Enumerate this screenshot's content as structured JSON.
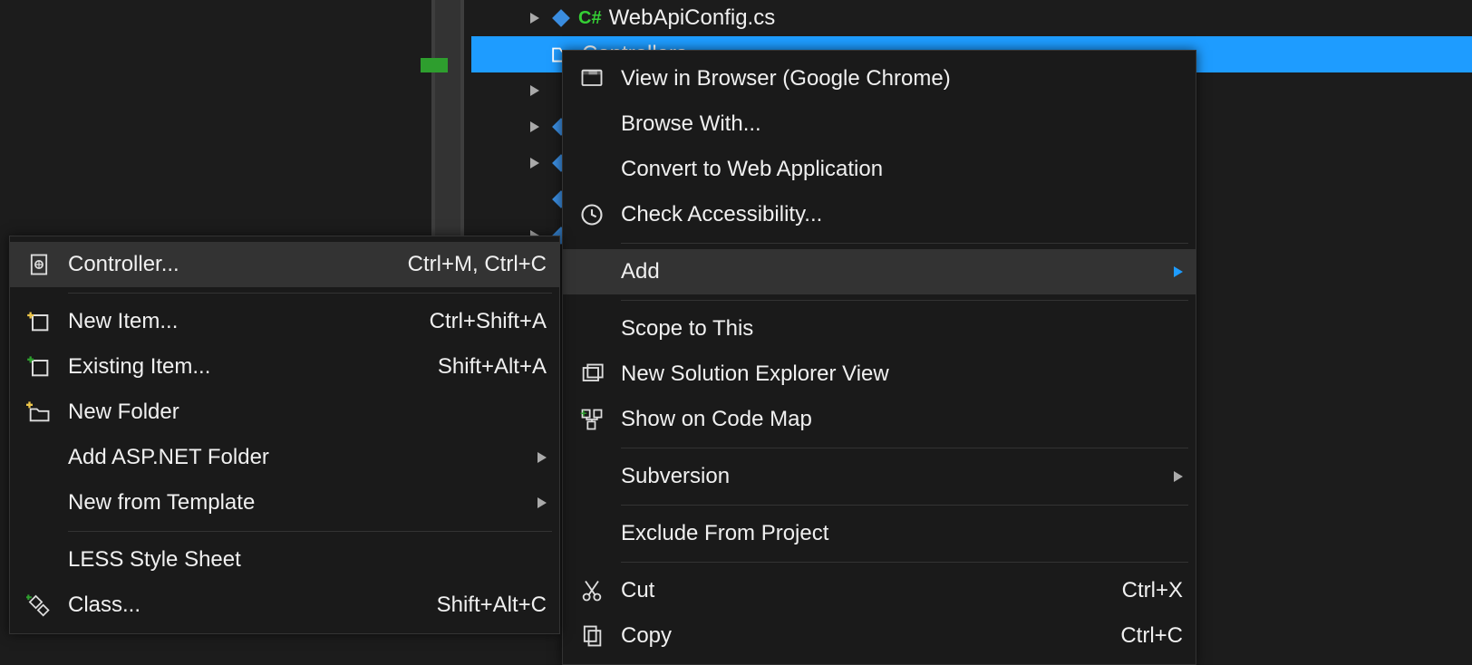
{
  "tree": {
    "file": "WebApiConfig.cs",
    "folder_selected": "Controllers"
  },
  "context_menu": {
    "view_in_browser": "View in Browser (Google Chrome)",
    "browse_with": "Browse With...",
    "convert_to_web": "Convert to Web Application",
    "check_accessibility": "Check Accessibility...",
    "add": "Add",
    "scope_to_this": "Scope to This",
    "new_solution_explorer": "New Solution Explorer View",
    "show_on_code_map": "Show on Code Map",
    "subversion": "Subversion",
    "exclude_from_project": "Exclude From Project",
    "cut": "Cut",
    "cut_shortcut": "Ctrl+X",
    "copy": "Copy",
    "copy_shortcut": "Ctrl+C"
  },
  "add_submenu": {
    "controller": "Controller...",
    "controller_shortcut": "Ctrl+M, Ctrl+C",
    "new_item": "New Item...",
    "new_item_shortcut": "Ctrl+Shift+A",
    "existing_item": "Existing Item...",
    "existing_item_shortcut": "Shift+Alt+A",
    "new_folder": "New Folder",
    "add_aspnet_folder": "Add ASP.NET Folder",
    "new_from_template": "New from Template",
    "less_style_sheet": "LESS Style Sheet",
    "class": "Class...",
    "class_shortcut": "Shift+Alt+C"
  }
}
